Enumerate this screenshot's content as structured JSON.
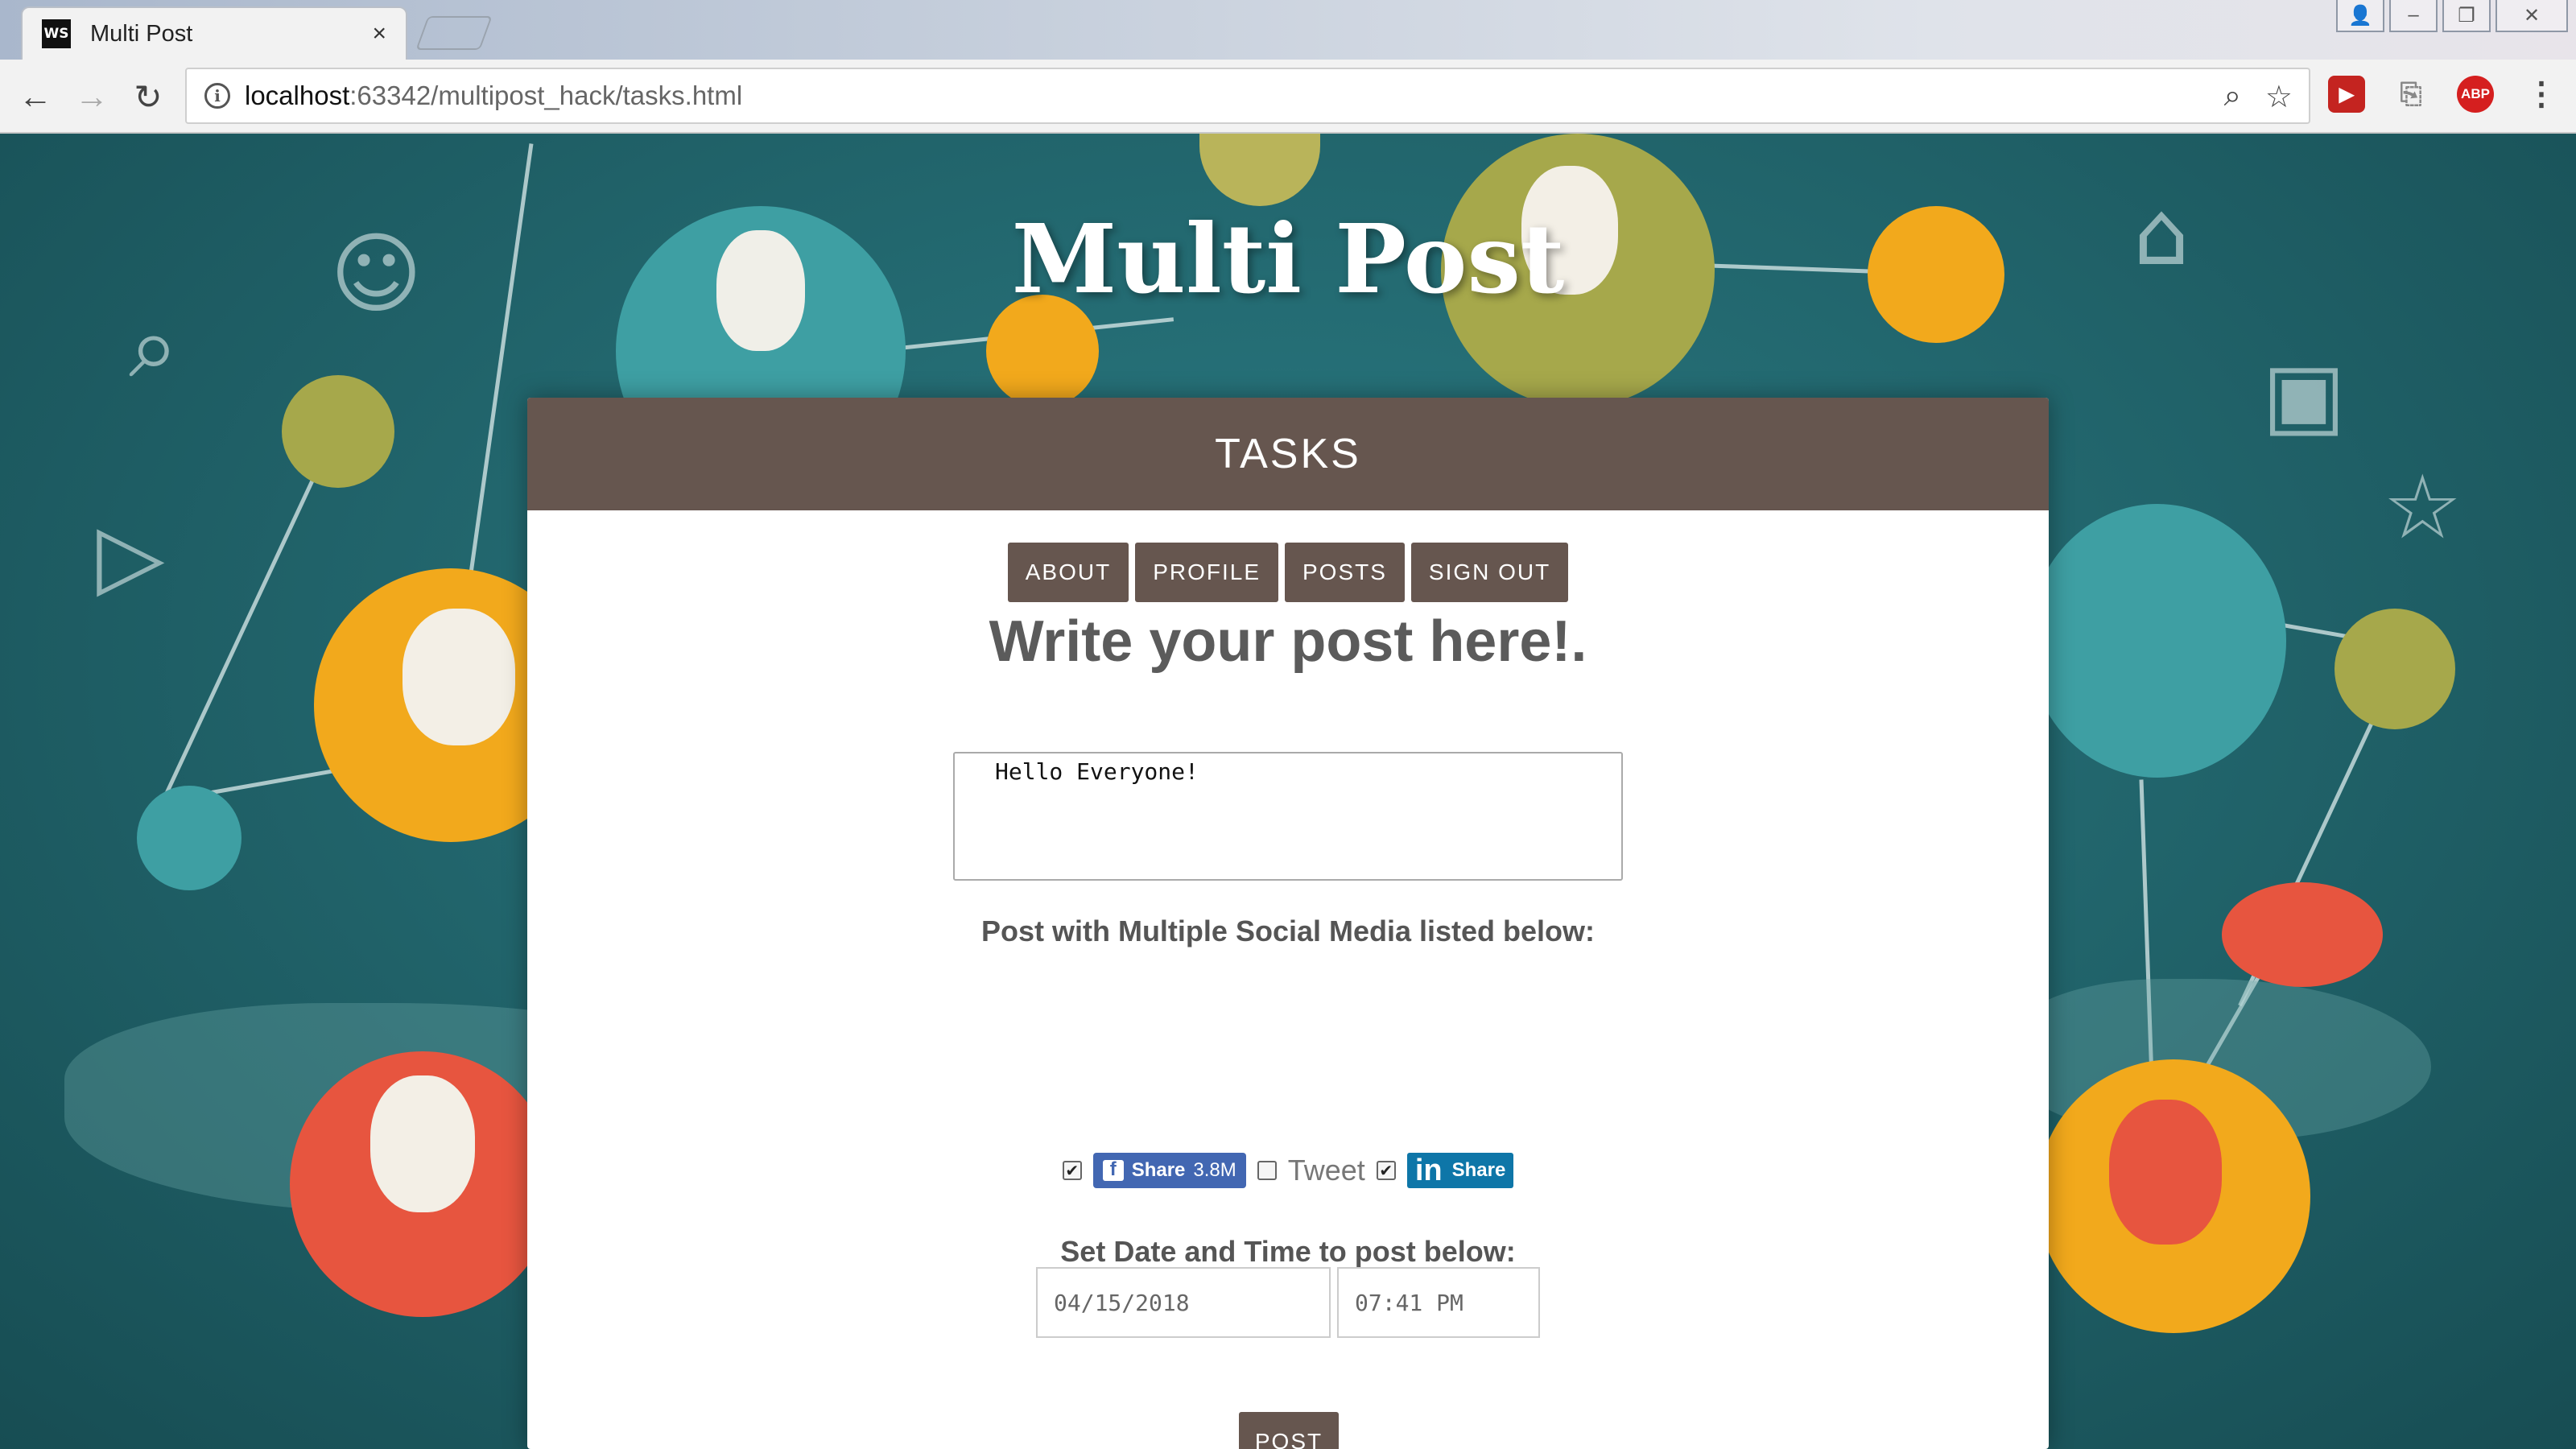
{
  "browser": {
    "tab_title": "Multi Post",
    "favicon_text": "WS",
    "tab_close": "×",
    "url_host": "localhost",
    "url_rest": ":63342/multipost_hack/tasks.html",
    "ext_abp": "ABP"
  },
  "site": {
    "title": "Multi Post"
  },
  "card": {
    "header": "TASKS",
    "menu": [
      "ABOUT",
      "PROFILE",
      "POSTS",
      "SIGN OUT"
    ],
    "heading": "Write your post here!.",
    "post_text": "Hello Everyone!",
    "social_label": "Post with Multiple Social Media listed below:",
    "facebook": {
      "label": "Share",
      "count": "3.8M",
      "checked": true
    },
    "twitter": {
      "label": "Tweet",
      "checked": false
    },
    "linkedin": {
      "label": "Share",
      "checked": true
    },
    "datetime_label": "Set Date and Time to post below:",
    "date_value": "04/15/2018",
    "time_value": "07:41 PM",
    "post_button": "POST"
  },
  "colors": {
    "brand_brown": "#66564f",
    "facebook_blue": "#4267b2",
    "linkedin_blue": "#0e76a8",
    "background_teal": "#21646b"
  }
}
